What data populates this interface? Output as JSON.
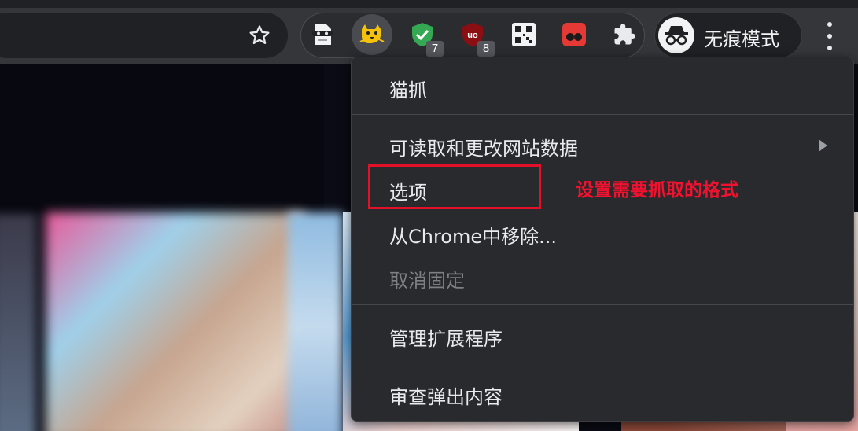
{
  "extensions": [
    {
      "name": "privacy-mask-extension",
      "badge": ""
    },
    {
      "name": "cat-extension",
      "badge": ""
    },
    {
      "name": "shield-check-extension",
      "badge": "7"
    },
    {
      "name": "ublock-extension",
      "badge": "8"
    },
    {
      "name": "qr-code-extension",
      "badge": ""
    },
    {
      "name": "red-dots-extension",
      "badge": ""
    },
    {
      "name": "puzzle-extensions-menu",
      "badge": ""
    }
  ],
  "incognito": {
    "label": "无痕模式"
  },
  "menu": {
    "title": "猫抓",
    "site_access": "可读取和更改网站数据",
    "options": "选项",
    "remove": "从Chrome中移除...",
    "unpin": "取消固定",
    "manage": "管理扩展程序",
    "inspect": "审查弹出内容"
  },
  "annotation": {
    "text": "设置需要抓取的格式"
  },
  "colors": {
    "annotation_red": "#f0122e",
    "toolbar": "#35363a",
    "menu_bg": "#292a2d"
  }
}
